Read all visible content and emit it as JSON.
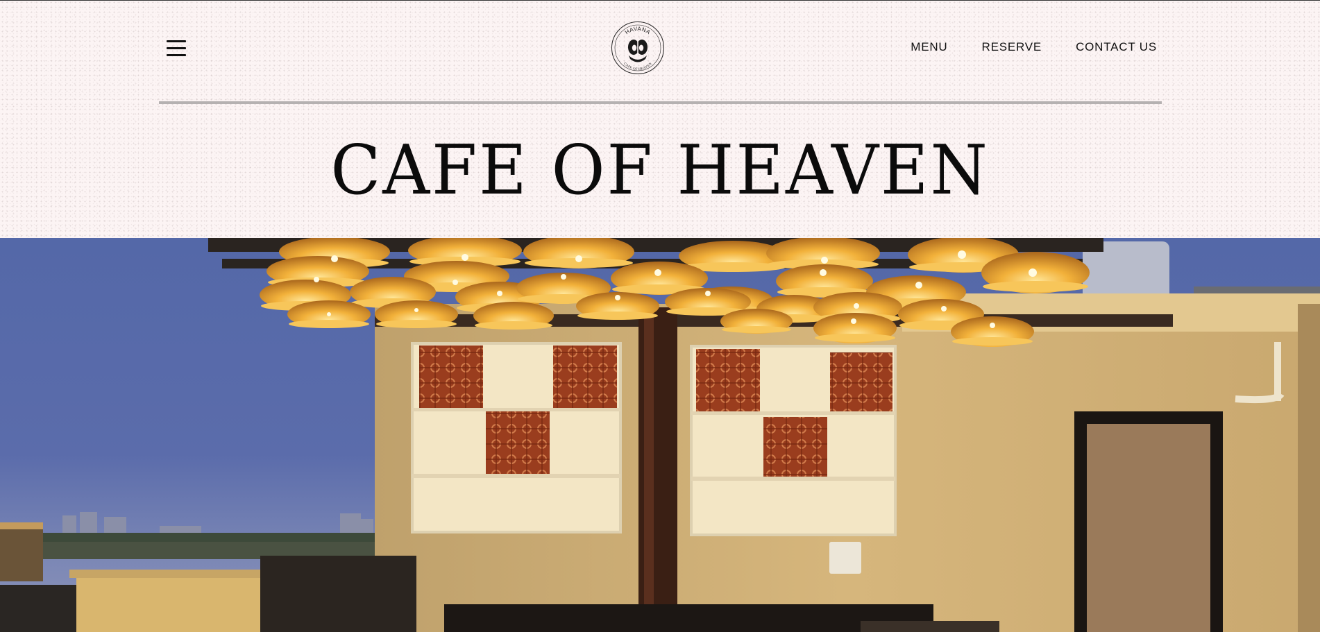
{
  "header": {
    "menu_icon": "hamburger-menu-icon",
    "logo": {
      "top_text": "HAVANA",
      "bottom_text": "CAFE OF HEAVEN"
    },
    "nav": [
      {
        "label": "MENU"
      },
      {
        "label": "RESERVE"
      },
      {
        "label": "CONTACT US"
      }
    ]
  },
  "hero": {
    "title": "CAFE OF HEAVEN",
    "image_description_icon": "rooftop-cafe-photo"
  },
  "colors": {
    "background": "#fcf4f4",
    "text": "#111111",
    "divider": "#b5b1b1",
    "lamp_glow": "#f2b13a"
  }
}
